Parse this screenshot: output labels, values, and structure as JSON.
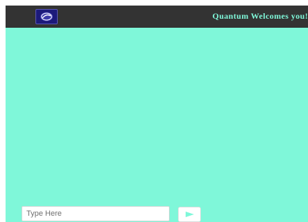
{
  "header": {
    "logo_icon": "brand-logo-icon",
    "title": "Quantum Welcomes you!"
  },
  "chat": {
    "messages": []
  },
  "composer": {
    "input_value": "",
    "input_placeholder": "Type Here",
    "send_icon": "send-arrow-icon"
  },
  "colors": {
    "background": "#7ff7d9",
    "header_background": "#333333",
    "header_text": "#7ff7d9",
    "send_icon": "#7ff7d9"
  }
}
